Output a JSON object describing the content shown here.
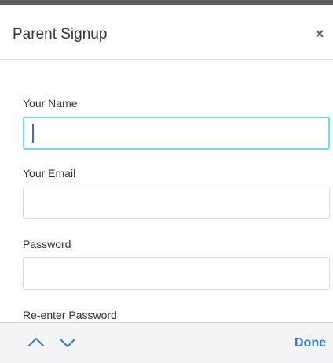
{
  "modal": {
    "title": "Parent Signup",
    "close_symbol": "×"
  },
  "form": {
    "fields": [
      {
        "label": "Your Name",
        "value": "",
        "placeholder": ""
      },
      {
        "label": "Your Email",
        "value": "",
        "placeholder": ""
      },
      {
        "label": "Password",
        "value": "",
        "placeholder": ""
      },
      {
        "label": "Re-enter Password",
        "value": "",
        "placeholder": ""
      }
    ]
  },
  "keyboard_bar": {
    "prev_icon": "chevron-up-icon",
    "next_icon": "chevron-down-icon",
    "done_label": "Done"
  },
  "colors": {
    "focus_border": "#66e0ef",
    "caret": "#3f6ad8",
    "done_blue": "#2a79d6",
    "top_strip": "#5f6063"
  }
}
